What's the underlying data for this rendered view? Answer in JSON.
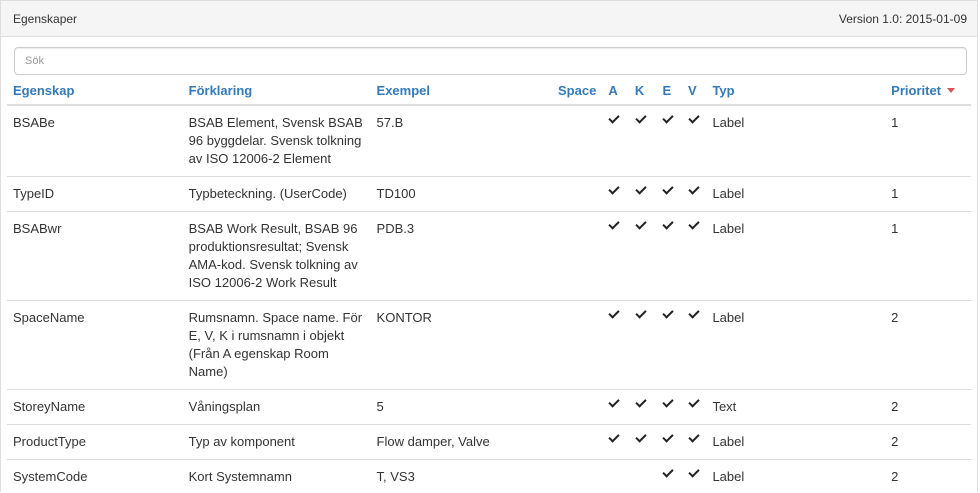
{
  "header": {
    "title": "Egenskaper",
    "version": "Version 1.0: 2015-01-09"
  },
  "search": {
    "placeholder": "Sök"
  },
  "table": {
    "columns": {
      "egenskap": "Egenskap",
      "forklaring": "Förklaring",
      "exempel": "Exempel",
      "space": "Space",
      "a": "A",
      "k": "K",
      "e": "E",
      "v": "V",
      "typ": "Typ",
      "prioritet": "Prioritet"
    },
    "sort": {
      "column": "prioritet",
      "direction": "descending",
      "indicator_color": "#d9534f"
    },
    "rows": [
      {
        "egenskap": "BSABe",
        "forklaring": "BSAB Element, Svensk BSAB 96 byggdelar. Svensk tolkning av ISO 12006-2 Element",
        "exempel": "57.B",
        "space": false,
        "a": true,
        "k": true,
        "e": true,
        "v": true,
        "typ": "Label",
        "prioritet": "1"
      },
      {
        "egenskap": "TypeID",
        "forklaring": "Typbeteckning. (UserCode)",
        "exempel": "TD100",
        "space": false,
        "a": true,
        "k": true,
        "e": true,
        "v": true,
        "typ": "Label",
        "prioritet": "1"
      },
      {
        "egenskap": "BSABwr",
        "forklaring": "BSAB Work Result, BSAB 96 produktionsresultat; Svensk AMA-kod. Svensk tolkning av ISO 12006-2 Work Result",
        "exempel": "PDB.3",
        "space": false,
        "a": true,
        "k": true,
        "e": true,
        "v": true,
        "typ": "Label",
        "prioritet": "1"
      },
      {
        "egenskap": "SpaceName",
        "forklaring": "Rumsnamn. Space name. För E, V, K i rumsnamn i objekt (Från A egenskap Room Name)",
        "exempel": "KONTOR",
        "space": false,
        "a": true,
        "k": true,
        "e": true,
        "v": true,
        "typ": "Label",
        "prioritet": "2"
      },
      {
        "egenskap": "StoreyName",
        "forklaring": "Våningsplan",
        "exempel": "5",
        "space": false,
        "a": true,
        "k": true,
        "e": true,
        "v": true,
        "typ": "Text",
        "prioritet": "2"
      },
      {
        "egenskap": "ProductType",
        "forklaring": "Typ av komponent",
        "exempel": "Flow damper, Valve",
        "space": false,
        "a": true,
        "k": true,
        "e": true,
        "v": true,
        "typ": "Label",
        "prioritet": "2"
      },
      {
        "egenskap": "SystemCode",
        "forklaring": "Kort Systemnamn",
        "exempel": "T, VS3",
        "space": false,
        "a": false,
        "k": false,
        "e": true,
        "v": true,
        "typ": "Label",
        "prioritet": "2"
      }
    ]
  },
  "colors": {
    "link": "#337ab7",
    "header_bg": "#f5f5f5",
    "border": "#dddddd"
  },
  "icons": {
    "check": "check-icon",
    "sort": "caret-down-icon"
  }
}
